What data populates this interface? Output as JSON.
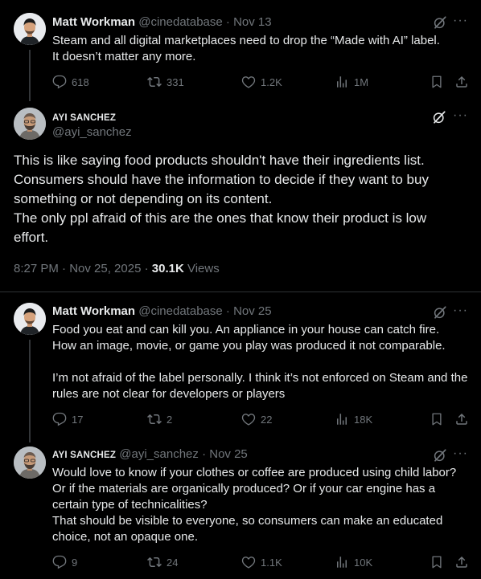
{
  "tweets": [
    {
      "name": "Matt Workman",
      "handle": "@cinedatabase",
      "time": "Nov 13",
      "text": "Steam and all digital marketplaces need to drop the “Made with AI” label.\nIt doesn’t matter any more.",
      "replies": "618",
      "retweets": "331",
      "likes": "1.2K",
      "views": "1M"
    },
    {
      "name": "AYI SANCHEZ",
      "handle": "@ayi_sanchez",
      "text": "This is like saying food products shouldn't have their ingredients list.\nConsumers should have the information to decide if they want to buy something or not depending on its content.\nThe only ppl afraid of this are the ones that know their product is low effort.",
      "timestamp": "8:27 PM · Nov 25, 2025",
      "views_count": "30.1K",
      "views_label": "Views"
    },
    {
      "name": "Matt Workman",
      "handle": "@cinedatabase",
      "time": "Nov 25",
      "text": "Food you eat and can kill you.  An appliance in your house can catch fire.\nHow an image, movie, or game you play was produced it not comparable.\n\nI’m not afraid of the label personally.  I think it’s not enforced on Steam and the rules are not clear for developers or players",
      "replies": "17",
      "retweets": "2",
      "likes": "22",
      "views": "18K"
    },
    {
      "name": "AYI SANCHEZ",
      "handle": "@ayi_sanchez",
      "time": "Nov 25",
      "text": "Would love to know if your clothes or coffee are produced using child labor?\nOr if the materials are organically produced? Or if your car engine has a certain type of technicalities?\nThat should be visible to everyone, so consumers can make an educated choice, not an opaque one.",
      "replies": "9",
      "retweets": "24",
      "likes": "1.1K",
      "views": "10K"
    }
  ],
  "icons": {
    "reply": "reply-icon",
    "retweet": "retweet-icon",
    "like": "like-icon",
    "views": "views-icon",
    "bookmark": "bookmark-icon",
    "share": "share-icon",
    "grok": "grok-icon",
    "more": "more-icon"
  },
  "colors": {
    "background": "#000000",
    "text": "#e7e9ea",
    "secondary": "#71767b",
    "divider": "#2f3336"
  }
}
